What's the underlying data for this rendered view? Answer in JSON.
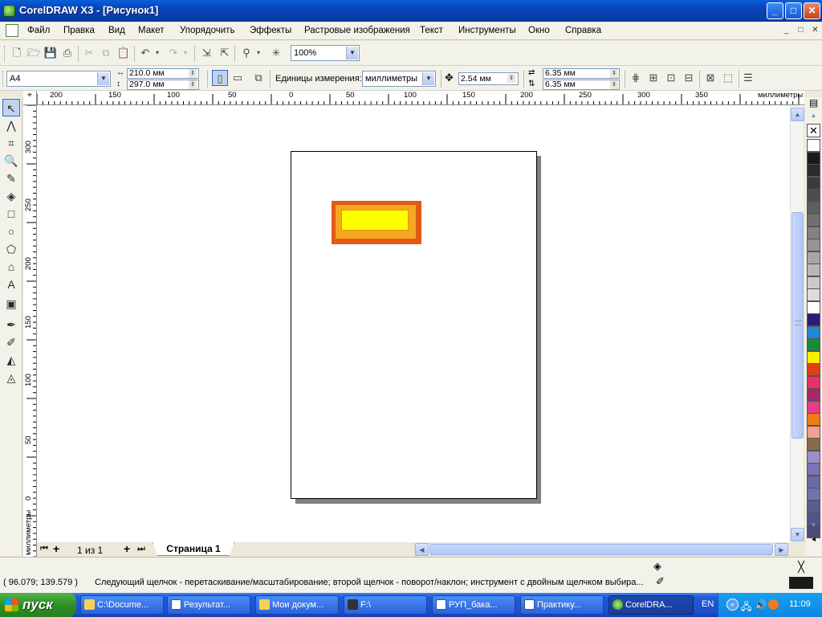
{
  "window": {
    "title": "CorelDRAW X3 - [Рисунок1]",
    "min": "_",
    "max": "□",
    "close": "✕"
  },
  "menu": {
    "items": [
      "Файл",
      "Правка",
      "Вид",
      "Макет",
      "Упорядочить",
      "Эффекты",
      "Растровые изображения",
      "Текст",
      "Инструменты",
      "Окно",
      "Справка"
    ],
    "mdi": [
      "_",
      "□",
      "✕"
    ]
  },
  "standard_toolbar": {
    "zoom": "100%"
  },
  "property_bar": {
    "paper_size": "A4",
    "width": "210.0 мм",
    "height": "297.0 мм",
    "units_label": "Единицы измерения:",
    "units_value": "миллиметры",
    "nudge": "2.54 мм",
    "dup_x": "6.35 мм",
    "dup_y": "6.35 мм"
  },
  "ruler": {
    "unit": "миллиметры",
    "h_ticks": [
      "200",
      "150",
      "100",
      "50",
      "0",
      "50",
      "100",
      "150",
      "200",
      "250",
      "300",
      "350"
    ],
    "v_ticks": [
      "300",
      "250",
      "200",
      "150",
      "100",
      "50",
      "0"
    ],
    "v_unit": "миллиметры"
  },
  "page_nav": {
    "counter": "1 из 1",
    "tab": "Страница 1"
  },
  "status": {
    "coords": "( 96.079; 139.579 )",
    "hint": "Следующий щелчок - перетаскивание/масштабирование; второй щелчок - поворот/наклон; инструмент с двойным щелчком выбира..."
  },
  "taskbar": {
    "start": "пуск",
    "tasks": [
      "C:\\Docume...",
      "Результат...",
      "Мои докум...",
      "F:\\",
      "РУП_бака...",
      "Практику...",
      "CorelDRA..."
    ],
    "lang": "EN",
    "time": "11:09"
  },
  "palette_colors": [
    "#ffffff",
    "#1a1a1a",
    "#2b2b2b",
    "#3c3c3c",
    "#4d4d4d",
    "#5e5e5e",
    "#707070",
    "#828282",
    "#949494",
    "#a6a6a6",
    "#b8b8b8",
    "#cacaca",
    "#dcdcdc",
    "#ffffff",
    "#2e1a78",
    "#1e88d8",
    "#148c3c",
    "#ffee00",
    "#e04010",
    "#e8306c",
    "#a4286a",
    "#e83c88",
    "#ee7c10",
    "#f0a090",
    "#8a6a4a",
    "#9a8ec8",
    "#7c74b4",
    "#6a6aa4",
    "#7272b0",
    "#5c5c94",
    "#54548a",
    "#4a4a7c"
  ],
  "drawing": {
    "outer_color": "#e35a15",
    "mid_color": "#f5a623",
    "inner_color": "#ffff00"
  }
}
